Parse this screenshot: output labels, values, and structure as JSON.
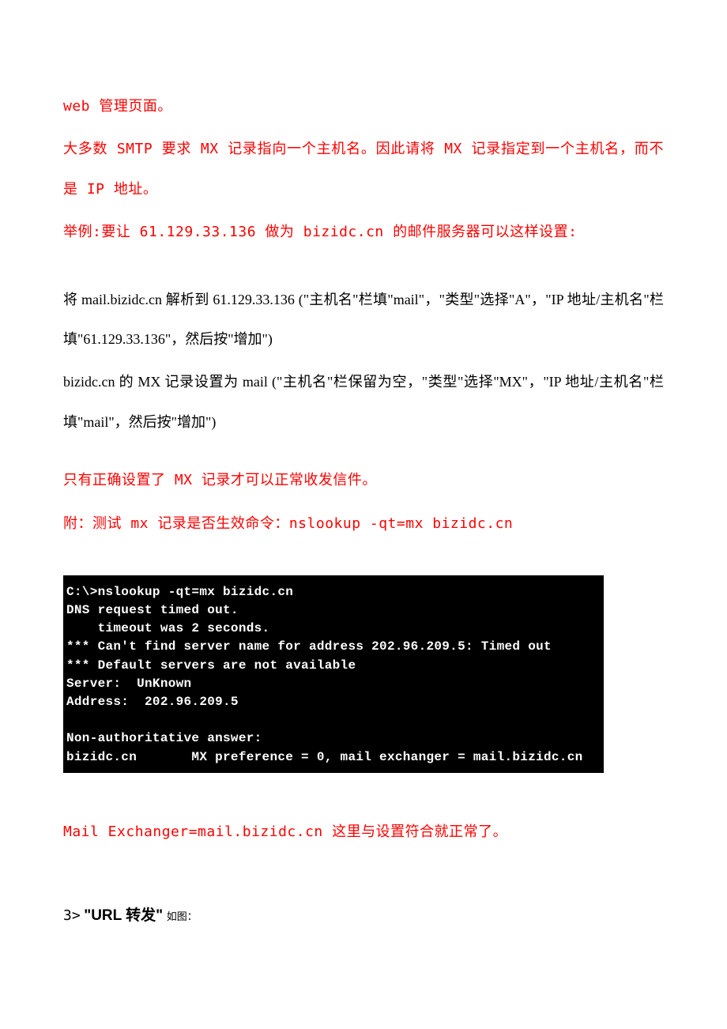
{
  "p1": "web 管理页面。",
  "p2": "大多数 SMTP 要求 MX 记录指向一个主机名。因此请将 MX 记录指定到一个主机名，而不是 IP 地址。",
  "p3": "举例:要让 61.129.33.136 做为 bizidc.cn 的邮件服务器可以这样设置:",
  "p4": "将 mail.bizidc.cn 解析到 61.129.33.136 (\"主机名\"栏填\"mail\"，\"类型\"选择\"A\"，\"IP 地址/主机名\"栏填\"61.129.33.136\"，然后按\"增加\")",
  "p5": "bizidc.cn 的 MX 记录设置为 mail (\"主机名\"栏保留为空，\"类型\"选择\"MX\"，\"IP 地址/主机名\"栏填\"mail\"，然后按\"增加\")",
  "p6": "只有正确设置了 MX 记录才可以正常收发信件。",
  "p7": "附：测试 mx 记录是否生效命令：nslookup -qt=mx bizidc.cn",
  "terminal": "C:\\>nslookup -qt=mx bizidc.cn\nDNS request timed out.\n    timeout was 2 seconds.\n*** Can't find server name for address 202.96.209.5: Timed out\n*** Default servers are not available\nServer:  UnKnown\nAddress:  202.96.209.5\n\nNon-authoritative answer:\nbizidc.cn       MX preference = 0, mail exchanger = mail.bizidc.cn",
  "p8": "Mail Exchanger=mail.bizidc.cn 这里与设置符合就正常了。",
  "section3": {
    "num": "3>",
    "title": "\"URL 转发\"",
    "suffix": "如图："
  }
}
